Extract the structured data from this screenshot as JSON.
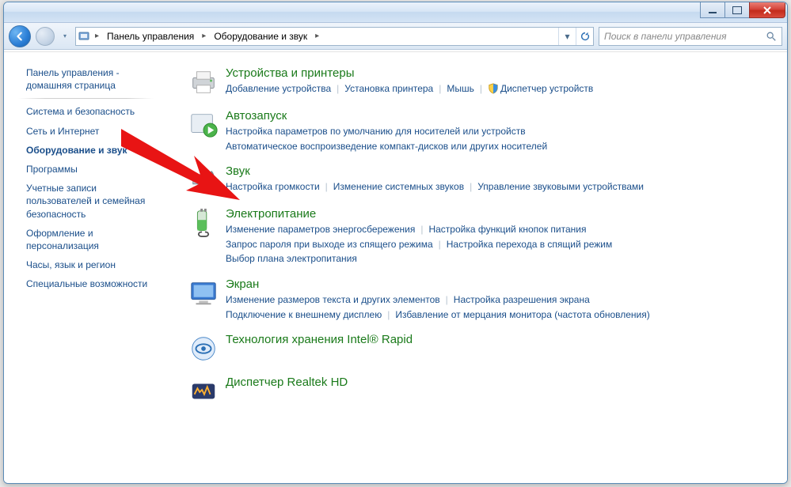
{
  "breadcrumb": {
    "seg1": "Панель управления",
    "seg2": "Оборудование и звук"
  },
  "search": {
    "placeholder": "Поиск в панели управления"
  },
  "sidebar": {
    "home1": "Панель управления -",
    "home2": "домашняя страница",
    "items": [
      "Система и безопасность",
      "Сеть и Интернет",
      "Оборудование и звук",
      "Программы",
      "Учетные записи пользователей и семейная безопасность",
      "Оформление и персонализация",
      "Часы, язык и регион",
      "Специальные возможности"
    ]
  },
  "categories": [
    {
      "title": "Устройства и принтеры",
      "links": [
        "Добавление устройства",
        "Установка принтера",
        "Мышь",
        "Диспетчер устройств"
      ],
      "lastHasShield": true
    },
    {
      "title": "Автозапуск",
      "links": [
        "Настройка параметров по умолчанию для носителей или устройств",
        "Автоматическое воспроизведение компакт-дисков или других носителей"
      ]
    },
    {
      "title": "Звук",
      "links": [
        "Настройка громкости",
        "Изменение системных звуков",
        "Управление звуковыми устройствами"
      ]
    },
    {
      "title": "Электропитание",
      "links": [
        "Изменение параметров энергосбережения",
        "Настройка функций кнопок питания",
        "Запрос пароля при выходе из спящего режима",
        "Настройка перехода в спящий режим",
        "Выбор плана электропитания"
      ]
    },
    {
      "title": "Экран",
      "links": [
        "Изменение размеров текста и других элементов",
        "Настройка разрешения экрана",
        "Подключение к внешнему дисплею",
        "Избавление от мерцания монитора (частота обновления)"
      ]
    },
    {
      "title": "Технология хранения Intel® Rapid",
      "links": []
    },
    {
      "title": "Диспетчер Realtek HD",
      "links": []
    }
  ]
}
